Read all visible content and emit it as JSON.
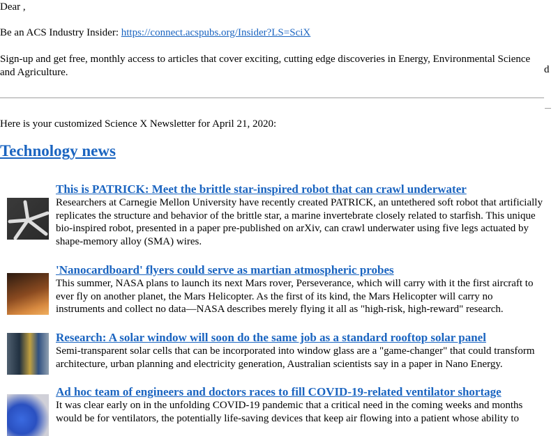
{
  "greeting": "Dear ,",
  "promo": {
    "prefix": "Be an ACS Industry Insider: ",
    "link": "https://connect.acspubs.org/Insider?LS=SciX",
    "description": "Sign-up and get free, monthly access to articles that cover exciting, cutting edge discoveries in Energy, Environmental Science and Agriculture.",
    "stray_char": "d"
  },
  "intro": "Here is your customized Science X Newsletter for April 21, 2020:",
  "section_title": "Technology news",
  "articles": [
    {
      "title": "This is PATRICK: Meet the brittle star-inspired robot that can crawl underwater",
      "summary": "Researchers at Carnegie Mellon University have recently created PATRICK, an untethered soft robot that artificially replicates the structure and behavior of the brittle star, a marine invertebrate closely related to starfish. This unique bio-inspired robot, presented in a paper pre-published on arXiv, can crawl underwater using five legs actuated by shape-memory alloy (SMA) wires.",
      "thumbnail": "brittle-star-robot-image"
    },
    {
      "title": "'Nanocardboard' flyers could serve as martian atmospheric probes",
      "summary": "This summer, NASA plans to launch its next Mars rover, Perseverance, which will carry with it the first aircraft to ever fly on another planet, the Mars Helicopter. As the first of its kind, the Mars Helicopter will carry no instruments and collect no data—NASA describes merely flying it all as \"high-risk, high-reward\" research.",
      "thumbnail": "nanocardboard-flyer-image"
    },
    {
      "title": "Research: A solar window will soon do the same job as a standard rooftop solar panel",
      "summary": "Semi-transparent solar cells that can be incorporated into window glass are a \"game-changer\" that could transform architecture, urban planning and electricity generation, Australian scientists say in a paper in Nano Energy.",
      "thumbnail": "solar-window-image"
    },
    {
      "title": "Ad hoc team of engineers and doctors races to fill COVID-19-related ventilator shortage",
      "summary": "It was clear early on in the unfolding COVID-19 pandemic that a critical need in the coming weeks and months would be for ventilators, the potentially life-saving devices that keep air flowing into a patient whose ability to",
      "thumbnail": "ventilator-image"
    }
  ]
}
